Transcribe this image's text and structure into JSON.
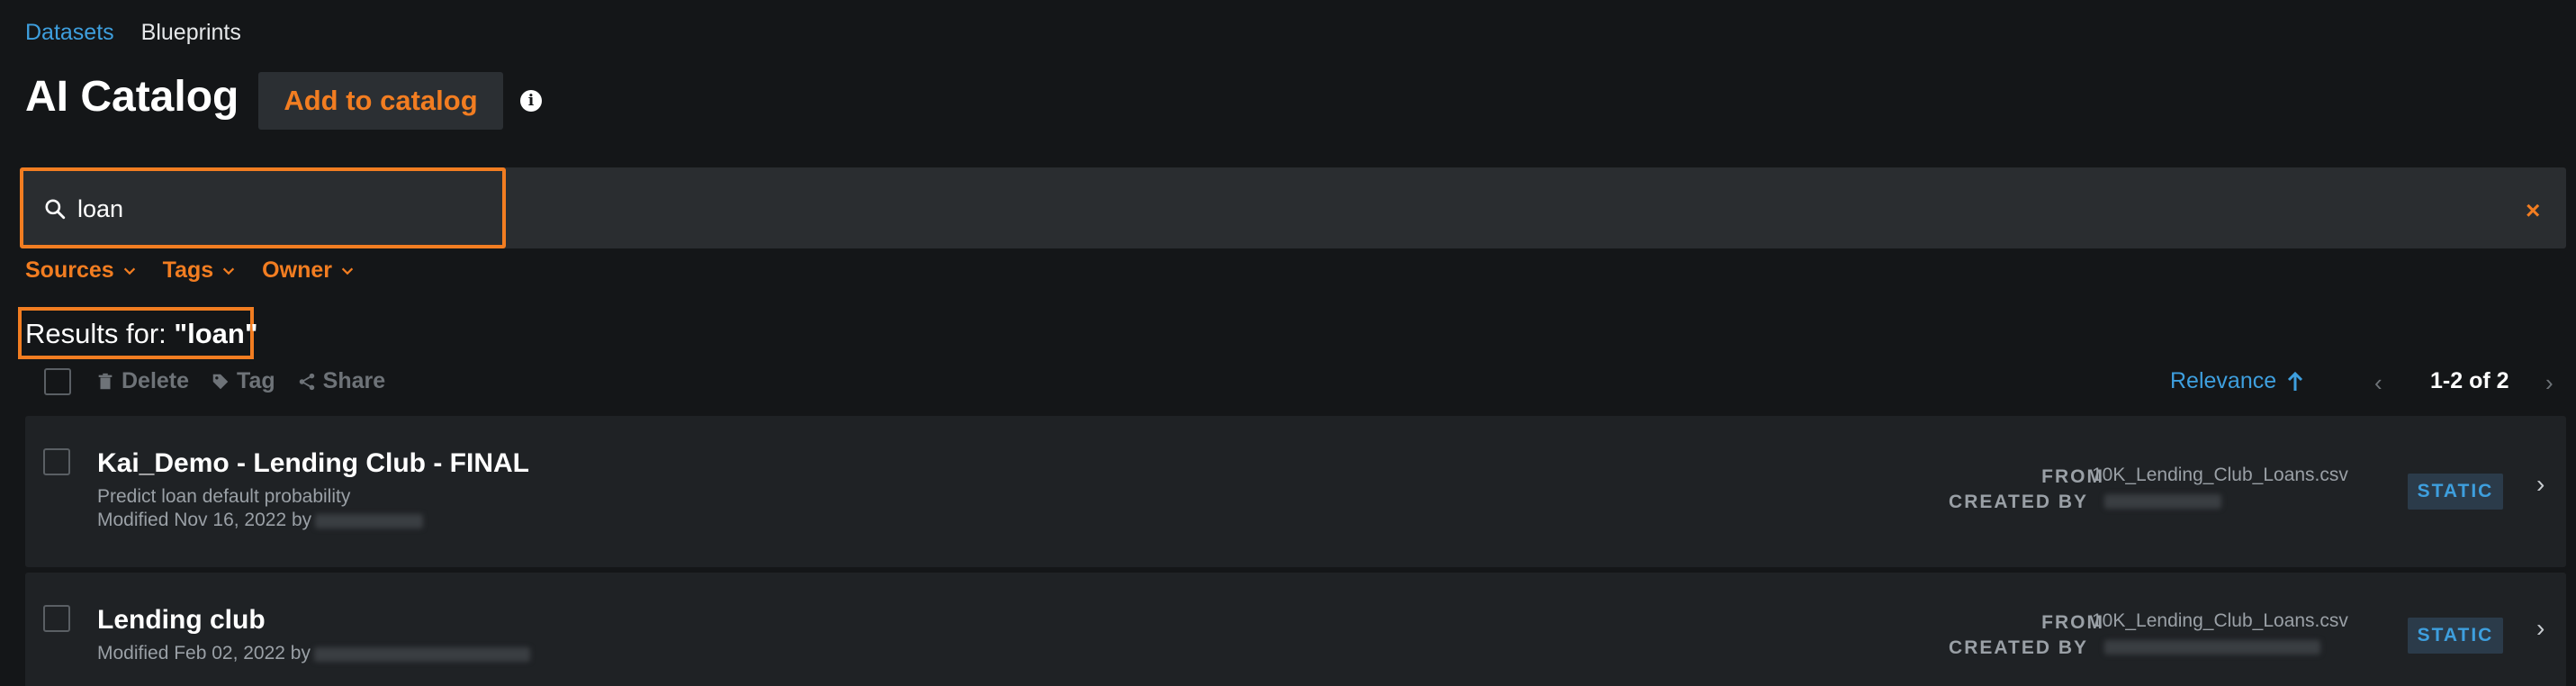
{
  "nav": {
    "tabs": [
      {
        "label": "Datasets",
        "active": true
      },
      {
        "label": "Blueprints",
        "active": false
      }
    ]
  },
  "header": {
    "title": "AI Catalog",
    "add_button_label": "Add to catalog",
    "info_icon": "info-icon"
  },
  "search": {
    "value": "loan",
    "placeholder": "",
    "clear_glyph": "×"
  },
  "filters": [
    {
      "label": "Sources"
    },
    {
      "label": "Tags"
    },
    {
      "label": "Owner"
    }
  ],
  "results": {
    "prefix": "Results for: ",
    "query_display": "\"loan\""
  },
  "toolbar": {
    "delete_label": "Delete",
    "tag_label": "Tag",
    "share_label": "Share",
    "sort_label": "Relevance",
    "pager_text": "1-2 of 2"
  },
  "items": [
    {
      "title": "Kai_Demo - Lending Club - FINAL",
      "description": "Predict loan default probability",
      "modified": "Modified Nov 16, 2022 by",
      "from_label": "FROM",
      "from_value": "10K_Lending_Club_Loans.csv",
      "created_label": "CREATED BY",
      "badge": "STATIC"
    },
    {
      "title": "Lending club",
      "description": "",
      "modified": "Modified Feb 02, 2022 by",
      "from_label": "FROM",
      "from_value": "10K_Lending_Club_Loans.csv",
      "created_label": "CREATED BY",
      "badge": "STATIC"
    }
  ],
  "colors": {
    "accent": "#f27d21",
    "link": "#3e9fde",
    "background": "#141618",
    "card": "#1f2225"
  }
}
